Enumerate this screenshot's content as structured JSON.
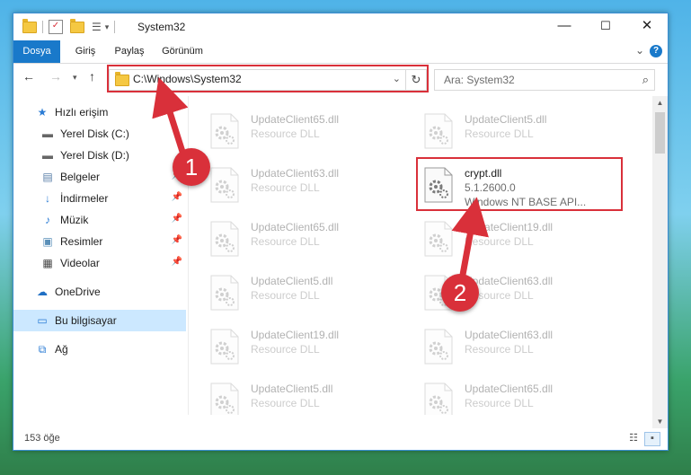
{
  "window": {
    "title": "System32",
    "controls": {
      "minimize": "—",
      "maximize": "☐",
      "close": "✕"
    }
  },
  "ribbon": {
    "tabs": [
      "Dosya",
      "Giriş",
      "Paylaş",
      "Görünüm"
    ],
    "help": "?",
    "expand": "⌄"
  },
  "nav": {
    "address": "C:\\Windows\\System32",
    "search_placeholder": "Ara: System32"
  },
  "sidebar": {
    "items": [
      {
        "label": "Hızlı erişim",
        "icon": "star-icon",
        "pinned": false
      },
      {
        "label": "Yerel Disk (C:)",
        "icon": "drive-icon",
        "pinned": false
      },
      {
        "label": "Yerel Disk (D:)",
        "icon": "drive-icon",
        "pinned": false
      },
      {
        "label": "Belgeler",
        "icon": "documents-icon",
        "pinned": true
      },
      {
        "label": "İndirmeler",
        "icon": "download-icon",
        "pinned": true
      },
      {
        "label": "Müzik",
        "icon": "music-icon",
        "pinned": true
      },
      {
        "label": "Resimler",
        "icon": "pictures-icon",
        "pinned": true
      },
      {
        "label": "Videolar",
        "icon": "videos-icon",
        "pinned": true
      },
      {
        "label": "OneDrive",
        "icon": "cloud-icon",
        "pinned": false
      },
      {
        "label": "Bu bilgisayar",
        "icon": "computer-icon",
        "pinned": false
      },
      {
        "label": "Ağ",
        "icon": "network-icon",
        "pinned": false
      }
    ]
  },
  "files": [
    {
      "name": "UpdateClient65.dll",
      "type": "Resource DLL"
    },
    {
      "name": "UpdateClient5.dll",
      "type": "Resource DLL"
    },
    {
      "name": "UpdateClient63.dll",
      "type": "Resource DLL"
    },
    {
      "name": "crypt.dll",
      "type": "5.1.2600.0",
      "desc": "Windows NT BASE API..."
    },
    {
      "name": "UpdateClient65.dll",
      "type": "Resource DLL"
    },
    {
      "name": "UpdateClient19.dll",
      "type": "Resource DLL"
    },
    {
      "name": "UpdateClient5.dll",
      "type": "Resource DLL"
    },
    {
      "name": "UpdateClient63.dll",
      "type": "Resource DLL"
    },
    {
      "name": "UpdateClient19.dll",
      "type": "Resource DLL"
    },
    {
      "name": "UpdateClient63.dll",
      "type": "Resource DLL"
    },
    {
      "name": "UpdateClient5.dll",
      "type": "Resource DLL"
    },
    {
      "name": "UpdateClient65.dll",
      "type": "Resource DLL"
    }
  ],
  "status": {
    "count": "153 öğe"
  },
  "annotations": {
    "callout1": "1",
    "callout2": "2"
  },
  "colors": {
    "accent": "#1979ca",
    "annotation": "#d9303a",
    "selected": "#cce8ff"
  }
}
